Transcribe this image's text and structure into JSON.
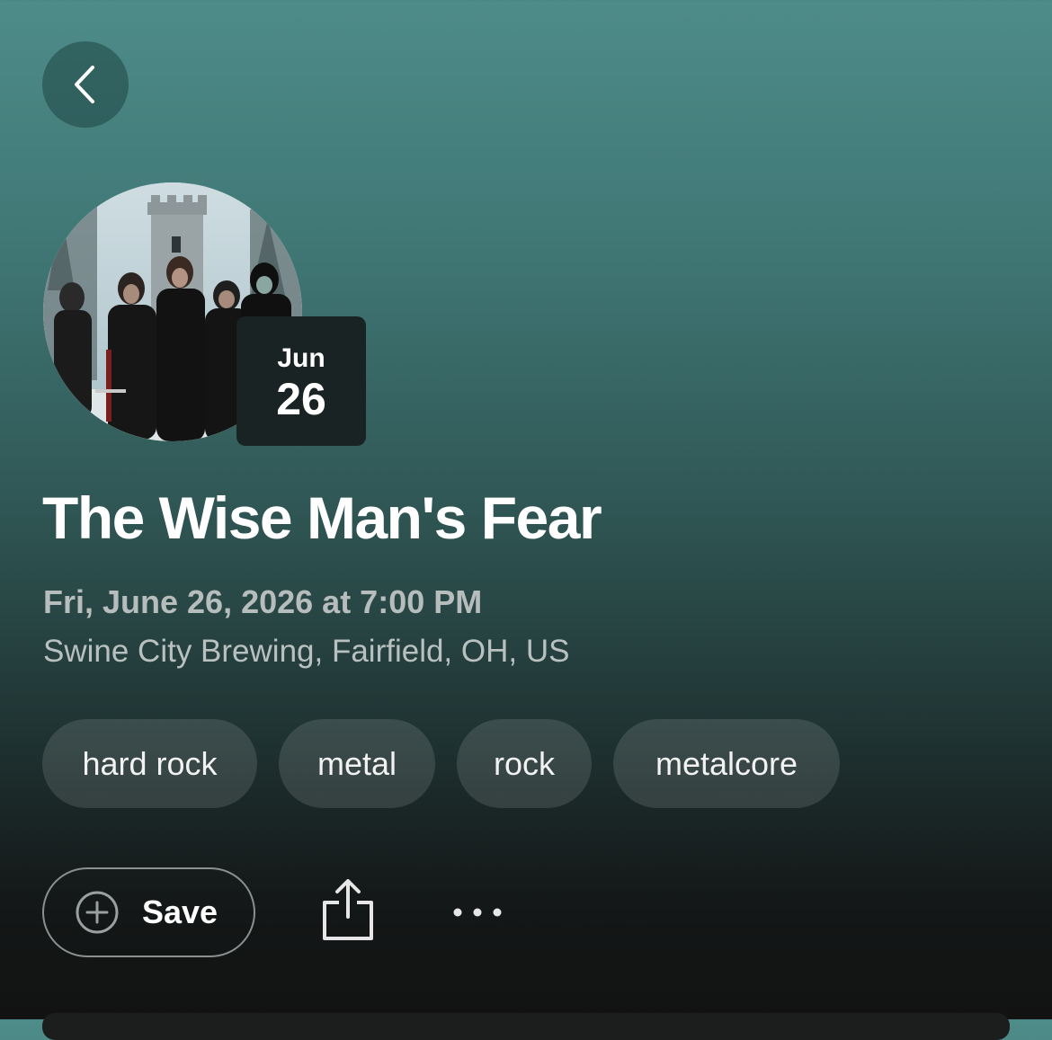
{
  "header": {
    "back_icon": "chevron-left-icon"
  },
  "event": {
    "date_badge": {
      "month": "Jun",
      "day": "26"
    },
    "title": "The Wise Man's Fear",
    "datetime": "Fri, June 26, 2026 at 7:00 PM",
    "venue": "Swine City Brewing, Fairfield, OH, US"
  },
  "tags": [
    {
      "label": "hard rock"
    },
    {
      "label": "metal"
    },
    {
      "label": "rock"
    },
    {
      "label": "metalcore"
    }
  ],
  "actions": {
    "save_label": "Save",
    "save_icon": "plus-circle-icon",
    "share_icon": "share-icon",
    "more_icon": "more-horizontal-icon"
  },
  "colors": {
    "gradient_top": "#4e8c89",
    "gradient_bottom": "#121212",
    "date_badge_bg": "#1a2323",
    "secondary_text": "#b6bdbc"
  }
}
